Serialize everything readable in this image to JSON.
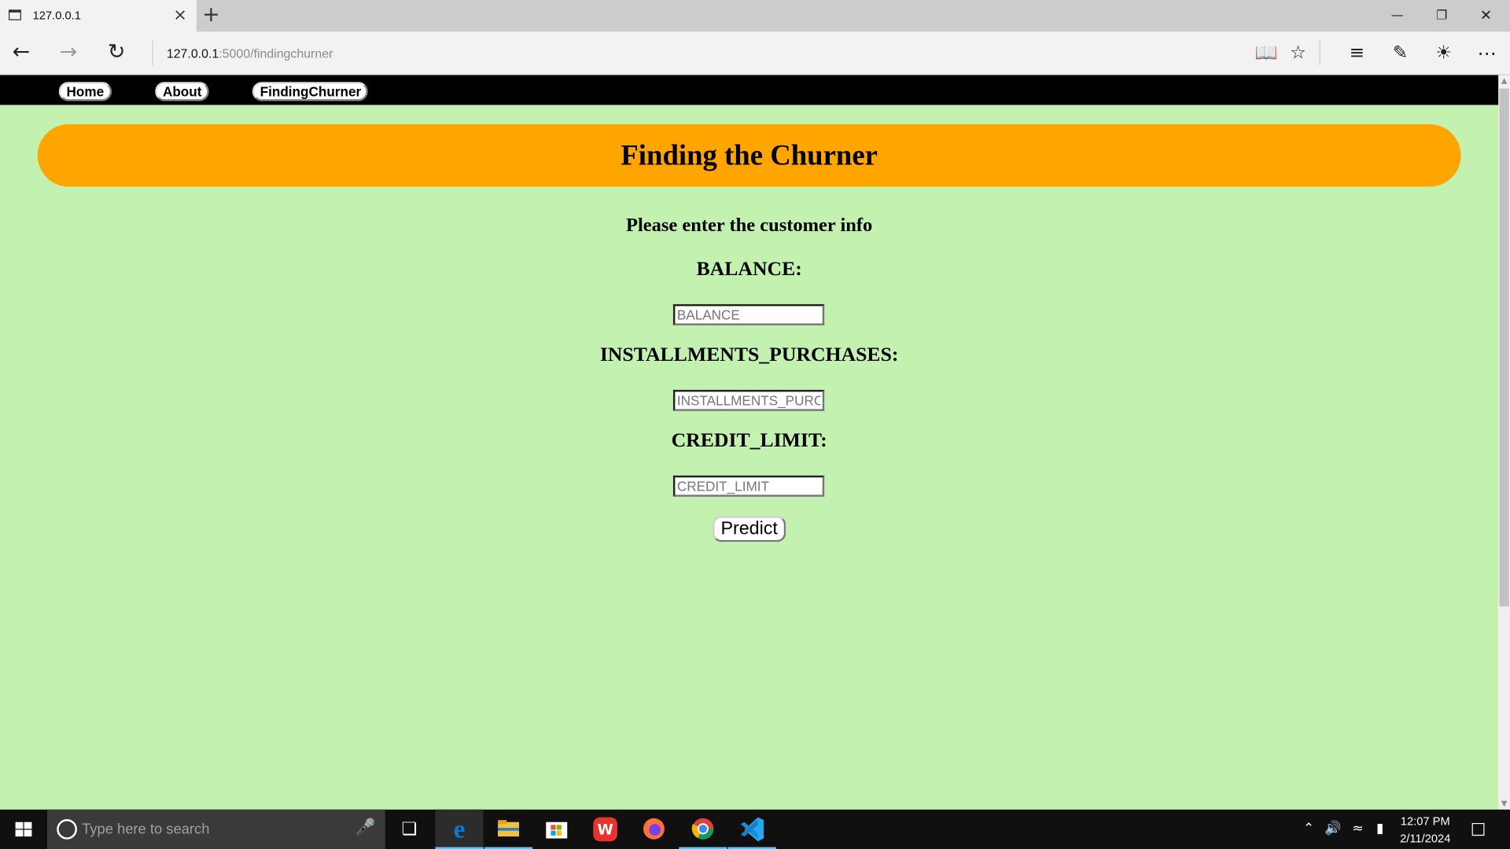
{
  "browser": {
    "tab_title": "127.0.0.1",
    "address_host": "127.0.0.1",
    "address_path": ":5000/findingchurner",
    "new_tab_glyph": "+",
    "close_tab_glyph": "×"
  },
  "site_nav": {
    "items": [
      {
        "label": "Home"
      },
      {
        "label": "About"
      },
      {
        "label": "FindingChurner"
      }
    ]
  },
  "page": {
    "title": "Finding the Churner",
    "prompt": "Please enter the customer info",
    "fields": [
      {
        "label": "BALANCE:",
        "placeholder": "BALANCE",
        "value": ""
      },
      {
        "label": "INSTALLMENTS_PURCHASES:",
        "placeholder": "INSTALLMENTS_PURCHASES",
        "value": ""
      },
      {
        "label": "CREDIT_LIMIT:",
        "placeholder": "CREDIT_LIMIT",
        "value": ""
      }
    ],
    "submit_label": "Predict"
  },
  "taskbar": {
    "search_placeholder": "Type here to search",
    "time": "12:07 PM",
    "date": "2/11/2024",
    "apps": [
      "task-view",
      "edge",
      "file-explorer",
      "store",
      "wps",
      "firefox",
      "chrome",
      "vscode"
    ]
  },
  "colors": {
    "page_background": "#c3f2b0",
    "banner": "#ffa500",
    "site_nav_background": "#000000",
    "taskbar": "#101010",
    "edge_blue": "#0a78d7",
    "vscode_blue": "#23a9f2"
  }
}
